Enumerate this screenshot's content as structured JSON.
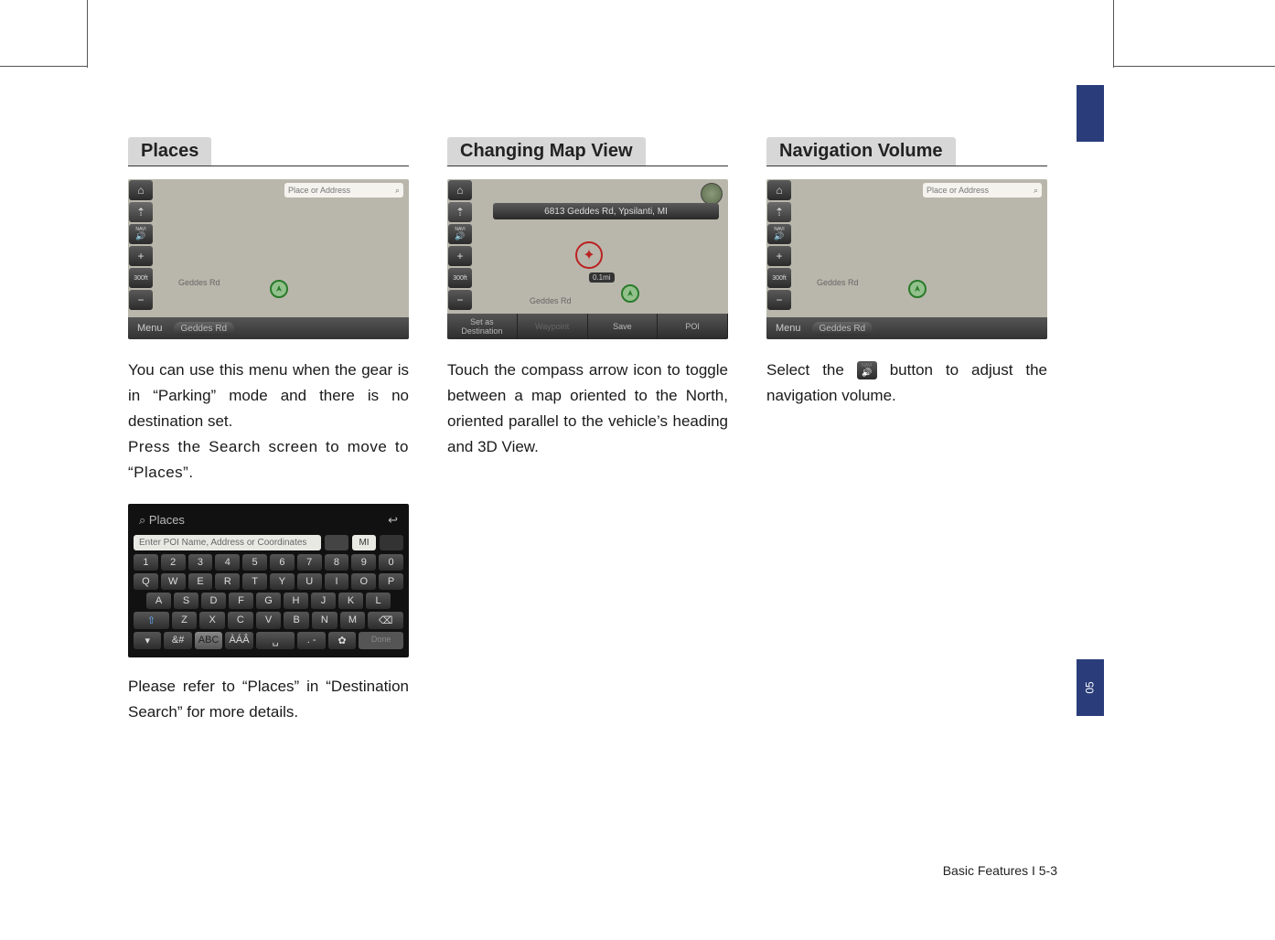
{
  "tab_number": "05",
  "footer": "Basic Features I 5-3",
  "col1": {
    "heading": "Places",
    "shot1": {
      "search_placeholder": "Place or Address",
      "road": "Geddes Rd",
      "menu": "Menu",
      "pill": "Geddes Rd"
    },
    "para1": "You can use this menu when the gear is in “Parking” mode and there is no destination set.",
    "para2": "Press the Search screen to move to “Places”.",
    "kb": {
      "title": "Places",
      "input_placeholder": "Enter POI Name, Address or Coordinates",
      "state": "MI",
      "row1": [
        "1",
        "2",
        "3",
        "4",
        "5",
        "6",
        "7",
        "8",
        "9",
        "0"
      ],
      "row2": [
        "Q",
        "W",
        "E",
        "R",
        "T",
        "Y",
        "U",
        "I",
        "O",
        "P"
      ],
      "row3": [
        "A",
        "S",
        "D",
        "F",
        "G",
        "H",
        "J",
        "K",
        "L"
      ],
      "row4": [
        "Z",
        "X",
        "C",
        "V",
        "B",
        "N",
        "M"
      ],
      "abc": "ABC",
      "alt": "ÀÁÂ",
      "symnum": "&#",
      "done": "Done"
    },
    "para3": "Please refer to “Places” in “Destination Search” for more details."
  },
  "col2": {
    "heading": "Changing Map View",
    "shot": {
      "address": "6813 Geddes Rd, Ypsilanti, MI",
      "distance": "0.1mi",
      "road": "Geddes Rd",
      "actions": {
        "dest_top": "Set as",
        "dest_bottom": "Destination",
        "waypoint": "Waypoint",
        "save": "Save",
        "poi": "POI"
      }
    },
    "para1": "Touch the compass arrow icon to toggle between a map oriented to the North, oriented parallel to the vehicle’s heading and 3D View."
  },
  "col3": {
    "heading": "Navigation Volume",
    "shot": {
      "search_placeholder": "Place or Address",
      "road": "Geddes Rd",
      "menu": "Menu",
      "pill": "Geddes Rd"
    },
    "para_a": "Select the ",
    "para_b": " button to adjust the navigation volume."
  }
}
